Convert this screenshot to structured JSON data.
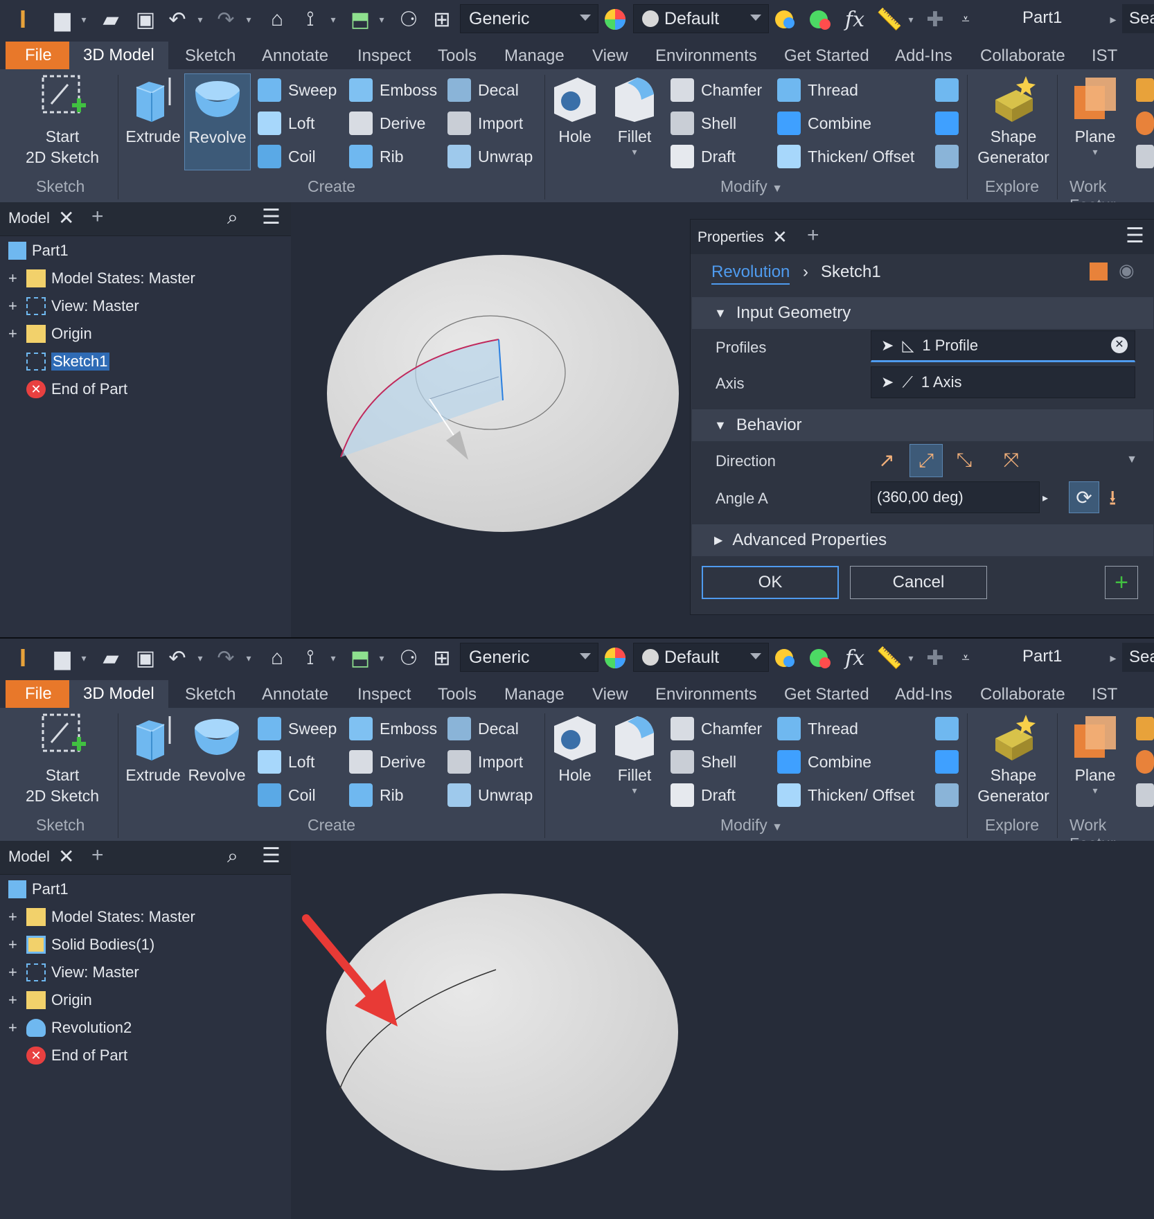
{
  "qab": {
    "material": "Generic",
    "appearance": "Default",
    "doc_title": "Part1",
    "search_placeholder": "Sea",
    "fx": "fx"
  },
  "tabs": [
    "File",
    "3D Model",
    "Sketch",
    "Annotate",
    "Inspect",
    "Tools",
    "Manage",
    "View",
    "Environments",
    "Get Started",
    "Add-Ins",
    "Collaborate",
    "IST"
  ],
  "ribbon": {
    "sketch": {
      "start_line1": "Start",
      "start_line2": "2D Sketch",
      "group": "Sketch"
    },
    "create": {
      "extrude": "Extrude",
      "revolve": "Revolve",
      "sweep": "Sweep",
      "loft": "Loft",
      "coil": "Coil",
      "emboss": "Emboss",
      "derive": "Derive",
      "rib": "Rib",
      "decal": "Decal",
      "import": "Import",
      "unwrap": "Unwrap",
      "group": "Create"
    },
    "modify": {
      "hole": "Hole",
      "fillet": "Fillet",
      "chamfer": "Chamfer",
      "shell": "Shell",
      "draft": "Draft",
      "thread": "Thread",
      "combine": "Combine",
      "thicken": "Thicken/ Offset",
      "group": "Modify"
    },
    "explore": {
      "shape_line1": "Shape",
      "shape_line2": "Generator",
      "group": "Explore"
    },
    "work": {
      "plane": "Plane",
      "group": "Work Featur"
    }
  },
  "browser": {
    "title": "Model",
    "top_items": [
      "Part1",
      "Model States: Master",
      "View: Master",
      "Origin",
      "Sketch1",
      "End of Part"
    ],
    "bottom_items": [
      "Part1",
      "Model States: Master",
      "Solid Bodies(1)",
      "View: Master",
      "Origin",
      "Revolution2",
      "End of Part"
    ]
  },
  "properties": {
    "title": "Properties",
    "breadcrumb_feature": "Revolution",
    "breadcrumb_sketch": "Sketch1",
    "section_input": "Input Geometry",
    "profiles_label": "Profiles",
    "profiles_value": "1 Profile",
    "axis_label": "Axis",
    "axis_value": "1 Axis",
    "section_behavior": "Behavior",
    "direction_label": "Direction",
    "angle_label": "Angle A",
    "angle_value": "(360,00 deg)",
    "section_advanced": "Advanced Properties",
    "ok": "OK",
    "cancel": "Cancel"
  },
  "colors": {
    "accent": "#4f9bef",
    "file_tab": "#e8782a",
    "annotation_arrow": "#e83a36"
  }
}
